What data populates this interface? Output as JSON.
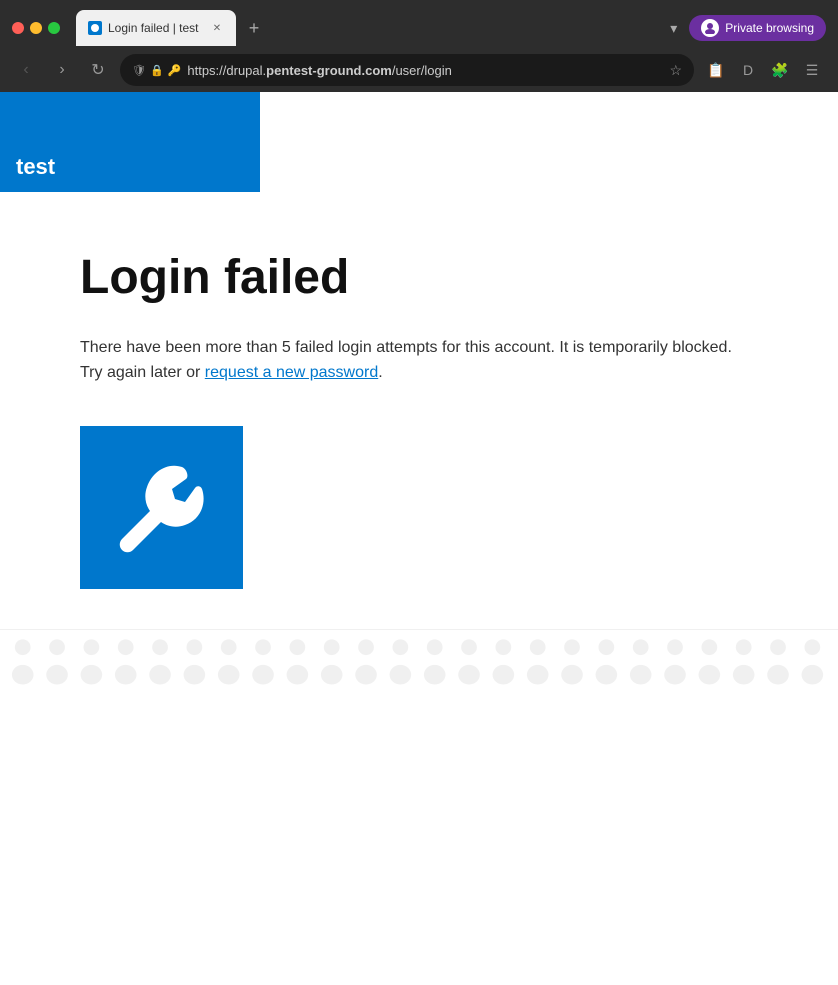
{
  "browser": {
    "tab": {
      "title": "Login failed | test",
      "favicon_color": "#0077cc"
    },
    "new_tab_label": "+",
    "private_browsing_label": "Private browsing",
    "address": {
      "full": "https://drupal.pentest-ground.com/user/login",
      "protocol": "https://",
      "subdomain": "drupal.",
      "domain": "pentest-ground.com",
      "path": "/user/login"
    },
    "nav": {
      "back": "‹",
      "forward": "›",
      "reload": "↻"
    }
  },
  "site": {
    "title": "test",
    "header_bg": "#0077cc"
  },
  "page": {
    "heading": "Login failed",
    "message_before_link": "There have been more than 5 failed login attempts for this account. It is temporarily blocked. Try again later or ",
    "link_text": "request a new password",
    "message_after_link": "."
  },
  "footer": {
    "icons": [
      "👤",
      "👤",
      "👤",
      "👤",
      "👤",
      "👤",
      "👤",
      "👤",
      "👤",
      "👤",
      "👤",
      "👤",
      "👤",
      "👤",
      "👤",
      "👤",
      "👤",
      "👤",
      "👤",
      "👤",
      "👤",
      "👤",
      "👤",
      "👤"
    ]
  }
}
